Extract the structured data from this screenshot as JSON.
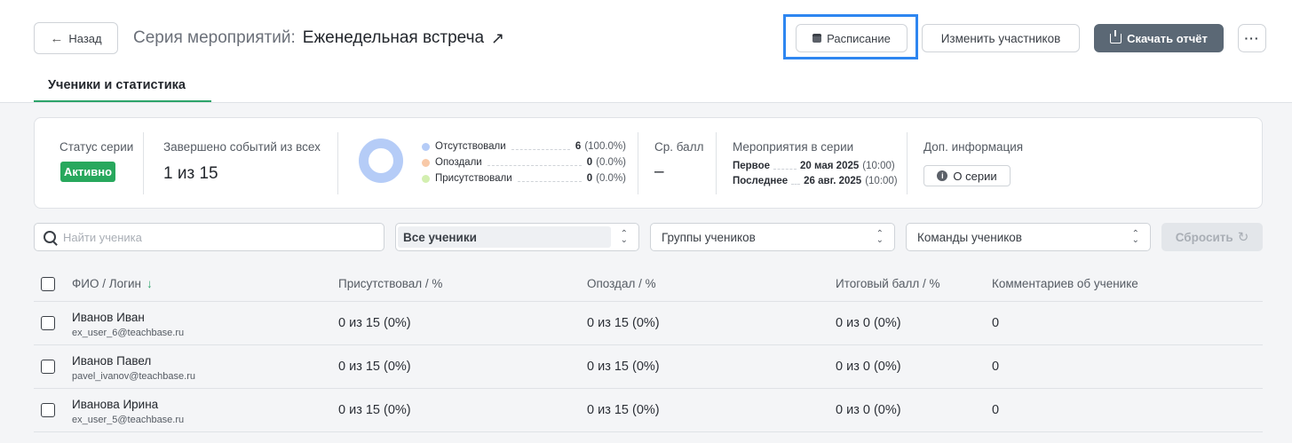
{
  "header": {
    "back_label": "Назад",
    "title_prefix": "Серия мероприятий:",
    "title_name": "Еженедельная встреча",
    "external_link_glyph": "↗",
    "schedule_label": "Расписание",
    "participants_label": "Изменить участников",
    "report_label": "Скачать отчёт",
    "more_glyph": "···"
  },
  "tabs": [
    {
      "label": "Ученики и статистика",
      "active": true
    }
  ],
  "stats": {
    "status_label": "Статус серии",
    "status_value": "Активно",
    "status_color": "#28a85d",
    "completed_label": "Завершено событий из всех",
    "completed_value": "1 из 15",
    "attendance": [
      {
        "label": "Отсутствовали",
        "count": "6",
        "pct": "(100.0%)",
        "color": "#b5ccf7"
      },
      {
        "label": "Опоздали",
        "count": "0",
        "pct": "(0.0%)",
        "color": "#f8c9a8"
      },
      {
        "label": "Присутствовали",
        "count": "0",
        "pct": "(0.0%)",
        "color": "#d3efb0"
      }
    ],
    "avg_label": "Ср. балл",
    "avg_value": "–",
    "series_label": "Мероприятия в серии",
    "first_label": "Первое",
    "first_date": "20 мая 2025",
    "first_time": "(10:00)",
    "last_label": "Последнее",
    "last_date": "26 авг. 2025",
    "last_time": "(10:00)",
    "info_label": "Доп. информация",
    "info_button": "О серии"
  },
  "filters": {
    "search_placeholder": "Найти ученика",
    "students_select": "Все ученики",
    "groups_select": "Группы учеников",
    "teams_select": "Команды учеников",
    "reset_label": "Сбросить"
  },
  "table": {
    "columns": {
      "name": "ФИО / Логин",
      "attended": "Присутствовал / %",
      "late": "Опоздал / %",
      "score": "Итоговый балл / %",
      "comments": "Комментариев об ученике"
    },
    "rows": [
      {
        "name": "Иванов Иван",
        "login": "ex_user_6@teachbase.ru",
        "attended": "0 из 15 (0%)",
        "late": "0 из 15 (0%)",
        "score": "0 из 0 (0%)",
        "comments": "0"
      },
      {
        "name": "Иванов Павел",
        "login": "pavel_ivanov@teachbase.ru",
        "attended": "0 из 15 (0%)",
        "late": "0 из 15 (0%)",
        "score": "0 из 0 (0%)",
        "comments": "0"
      },
      {
        "name": "Иванова Ирина",
        "login": "ex_user_5@teachbase.ru",
        "attended": "0 из 15 (0%)",
        "late": "0 из 15 (0%)",
        "score": "0 из 0 (0%)",
        "comments": "0"
      }
    ]
  },
  "colors": {
    "accent_green": "#2ca36a",
    "primary_button": "#5b6875",
    "highlight_frame": "#2e86f0"
  }
}
